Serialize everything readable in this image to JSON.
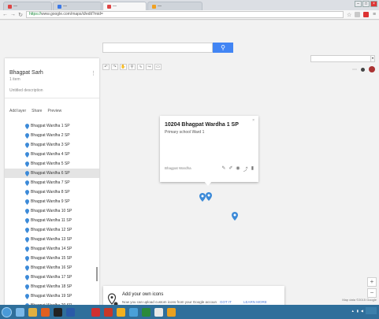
{
  "browser": {
    "tabs": [
      {
        "label": "—",
        "favicon": "red-icon",
        "active": false
      },
      {
        "label": "—",
        "favicon": "blue-icon",
        "active": false
      },
      {
        "label": "—",
        "favicon": "red-icon",
        "active": true
      },
      {
        "label": "—",
        "favicon": "orange-icon",
        "active": false
      }
    ],
    "url_scheme": "https://",
    "url_rest": "www.google.com/maps/d/edit?mid="
  },
  "panel": {
    "title": "Bhagpat Sarh",
    "subtitle": "1 item",
    "description": "Untitled description",
    "layer_tools": [
      "Add layer",
      "Share",
      "Preview"
    ],
    "items": [
      {
        "label": "Bhagpat Wardha 1 SP",
        "selected": false
      },
      {
        "label": "Bhagpat Wardha 2 SP",
        "selected": false
      },
      {
        "label": "Bhagpat Wardha 3 SP",
        "selected": false
      },
      {
        "label": "Bhagpat Wardha 4 SP",
        "selected": false
      },
      {
        "label": "Bhagpat Wardha 5 SP",
        "selected": false
      },
      {
        "label": "Bhagpat Wardha 6 SP",
        "selected": true
      },
      {
        "label": "Bhagpat Wardha 7 SP",
        "selected": false
      },
      {
        "label": "Bhagpat Wardha 8 SP",
        "selected": false
      },
      {
        "label": "Bhagpat Wardha 9 SP",
        "selected": false
      },
      {
        "label": "Bhagpat Wardha 10 SP",
        "selected": false
      },
      {
        "label": "Bhagpat Wardha 11 SP",
        "selected": false
      },
      {
        "label": "Bhagpat Wardha 12 SP",
        "selected": false
      },
      {
        "label": "Bhagpat Wardha 13 SP",
        "selected": false
      },
      {
        "label": "Bhagpat Wardha 14 SP",
        "selected": false
      },
      {
        "label": "Bhagpat Wardha 15 SP",
        "selected": false
      },
      {
        "label": "Bhagpat Wardha 16 SP",
        "selected": false
      },
      {
        "label": "Bhagpat Wardha 17 SP",
        "selected": false
      },
      {
        "label": "Bhagpat Wardha 18 SP",
        "selected": false
      },
      {
        "label": "Bhagpat Wardha 19 SP",
        "selected": false
      },
      {
        "label": "Bhagpat Wardha 20 SP",
        "selected": false
      }
    ]
  },
  "popup": {
    "title": "10204 Bhagpat Wardha 1 SP",
    "subtitle": "Primary school Ward 1",
    "footer": "Bhagpat Wardha",
    "close": "×"
  },
  "toast": {
    "title": "Add your own icons",
    "text": "Now you can upload custom icons from your Google account.",
    "action1": "GOT IT",
    "action2": "LEARN MORE"
  },
  "map": {
    "footer": "Map data ©2015 Google"
  },
  "colors": {
    "accent": "#4285f4",
    "pin": "#3c8ad8",
    "taskbar": "#2f6f9b"
  }
}
